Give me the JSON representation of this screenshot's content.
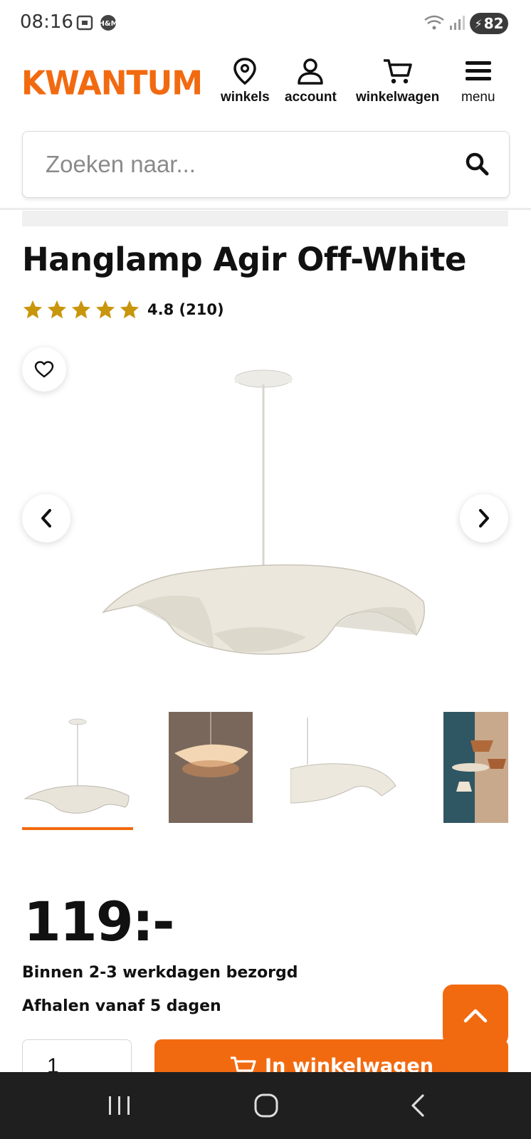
{
  "status_bar": {
    "time": "08:16",
    "battery": "82"
  },
  "brand": {
    "logo_text": "KWANTUM",
    "accent": "#f26a10"
  },
  "header": {
    "nav": [
      {
        "label": "winkels",
        "icon": "location-pin-icon"
      },
      {
        "label": "account",
        "icon": "user-icon"
      },
      {
        "label": "winkelwagen",
        "icon": "cart-icon"
      },
      {
        "label": "menu",
        "icon": "hamburger-icon"
      }
    ]
  },
  "search": {
    "placeholder": "Zoeken naar..."
  },
  "product": {
    "title": "Hanglamp Agir Off-White",
    "rating_text": "4.8 (210)",
    "rating": 4.8,
    "star_color": "#c8960c",
    "price": "119:-",
    "delivery": "Binnen 2-3 werkdagen bezorgd",
    "pickup": "Afhalen vanaf 5 dagen",
    "quantity": "1",
    "add_to_cart": "In winkelwagen"
  },
  "gallery": {
    "thumbnail_count": 4,
    "selected_index": 0
  }
}
